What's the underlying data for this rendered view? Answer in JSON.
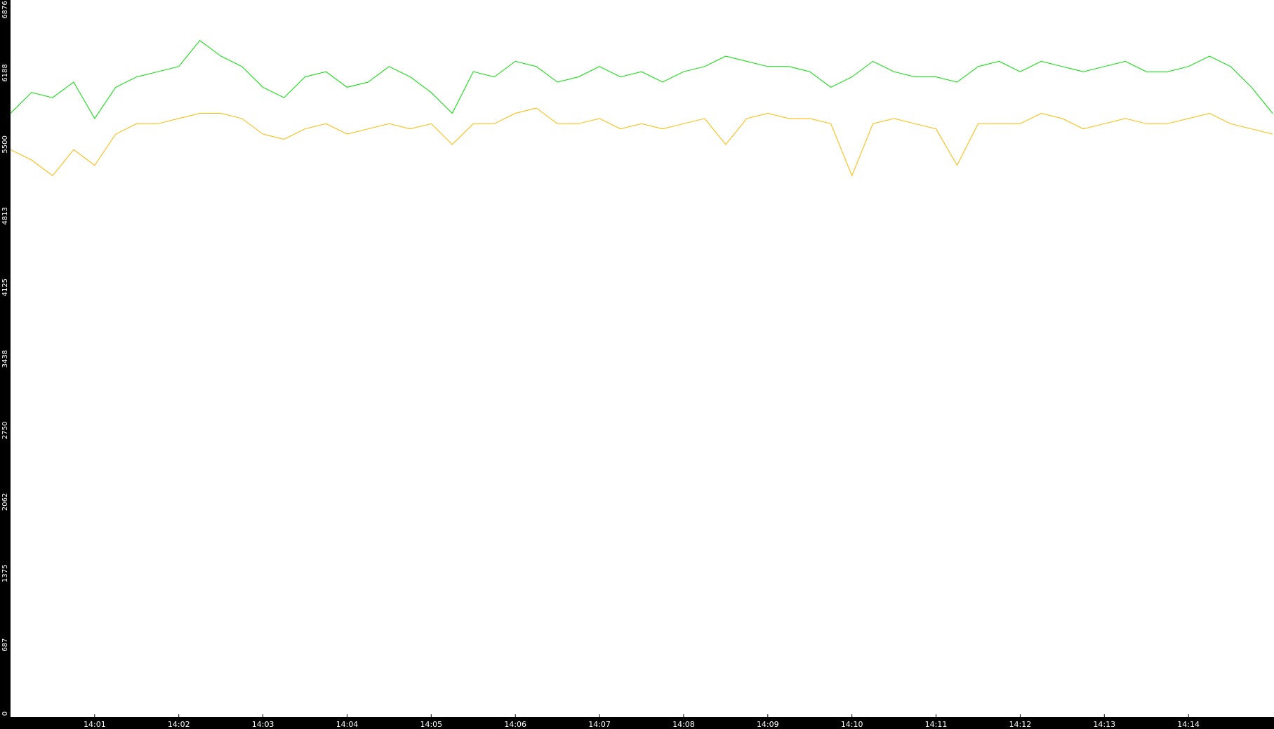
{
  "chart_data": {
    "type": "line",
    "title": "",
    "xlabel": "",
    "ylabel": "",
    "x_ticks": [
      "14:01",
      "14:02",
      "14:03",
      "14:04",
      "14:05",
      "14:06",
      "14:07",
      "14:08",
      "14:09",
      "14:10",
      "14:11",
      "14:12",
      "14:13",
      "14:14"
    ],
    "y_ticks": [
      "0",
      "687",
      "1375",
      "2062",
      "2750",
      "3438",
      "4125",
      "4813",
      "5500",
      "6188",
      "6876"
    ],
    "ylim": [
      0,
      6876
    ],
    "xlim": [
      "14:00:00",
      "14:15:00"
    ],
    "grid": false,
    "legend": "none",
    "colors": {
      "background": "#ffffff",
      "axis_strip": "#000000",
      "series_green": "#00e000",
      "series_orange": "#ffb800"
    },
    "x": [
      "14:00:00",
      "14:00:15",
      "14:00:30",
      "14:00:45",
      "14:01:00",
      "14:01:15",
      "14:01:30",
      "14:01:45",
      "14:02:00",
      "14:02:15",
      "14:02:30",
      "14:02:45",
      "14:03:00",
      "14:03:15",
      "14:03:30",
      "14:03:45",
      "14:04:00",
      "14:04:15",
      "14:04:30",
      "14:04:45",
      "14:05:00",
      "14:05:15",
      "14:05:30",
      "14:05:45",
      "14:06:00",
      "14:06:15",
      "14:06:30",
      "14:06:45",
      "14:07:00",
      "14:07:15",
      "14:07:30",
      "14:07:45",
      "14:08:00",
      "14:08:15",
      "14:08:30",
      "14:08:45",
      "14:09:00",
      "14:09:15",
      "14:09:30",
      "14:09:45",
      "14:10:00",
      "14:10:15",
      "14:10:30",
      "14:10:45",
      "14:11:00",
      "14:11:15",
      "14:11:30",
      "14:11:45",
      "14:12:00",
      "14:12:15",
      "14:12:30",
      "14:12:45",
      "14:13:00",
      "14:13:15",
      "14:13:30",
      "14:13:45",
      "14:14:00",
      "14:14:15",
      "14:14:30",
      "14:14:45",
      "14:15:00"
    ],
    "series": [
      {
        "color": "#00e000",
        "values": [
          5800,
          6000,
          5950,
          6100,
          5750,
          6050,
          6150,
          6200,
          6250,
          6500,
          6350,
          6250,
          6050,
          5950,
          6150,
          6200,
          6050,
          6100,
          6250,
          6150,
          6000,
          5800,
          6200,
          6150,
          6300,
          6250,
          6100,
          6150,
          6250,
          6150,
          6200,
          6100,
          6200,
          6250,
          6350,
          6300,
          6250,
          6250,
          6200,
          6050,
          6150,
          6300,
          6200,
          6150,
          6150,
          6100,
          6250,
          6300,
          6200,
          6300,
          6250,
          6200,
          6250,
          6300,
          6200,
          6200,
          6250,
          6350,
          6250,
          6050,
          5800
        ]
      },
      {
        "color": "#ffb800",
        "values": [
          5450,
          5350,
          5200,
          5450,
          5300,
          5600,
          5700,
          5700,
          5750,
          5800,
          5800,
          5750,
          5600,
          5550,
          5650,
          5700,
          5600,
          5650,
          5700,
          5650,
          5700,
          5500,
          5700,
          5700,
          5800,
          5850,
          5700,
          5700,
          5750,
          5650,
          5700,
          5650,
          5700,
          5750,
          5500,
          5750,
          5800,
          5750,
          5750,
          5700,
          5200,
          5700,
          5750,
          5700,
          5650,
          5300,
          5700,
          5700,
          5700,
          5800,
          5750,
          5650,
          5700,
          5750,
          5700,
          5700,
          5750,
          5800,
          5700,
          5650,
          5600
        ]
      }
    ]
  }
}
